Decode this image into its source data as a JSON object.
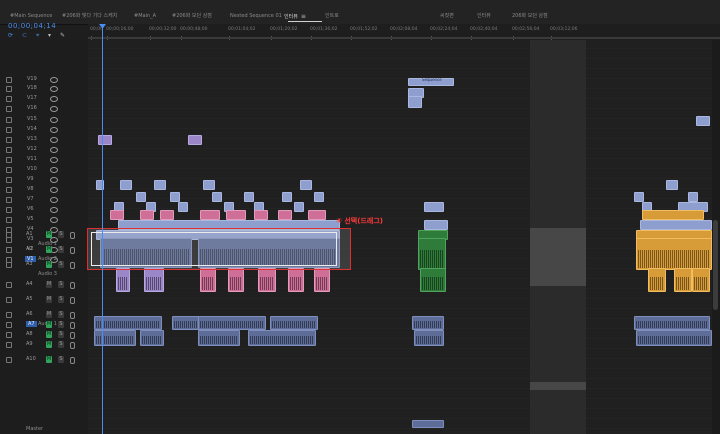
{
  "tabs": [
    {
      "label": "#Main Sequence",
      "active": false
    },
    {
      "label": "#206화 빛다 기다 스케치",
      "active": false
    },
    {
      "label": "#Main_A",
      "active": false
    },
    {
      "label": "#206화 모던 상점",
      "active": false
    },
    {
      "label": "Nested Sequence 01",
      "active": false
    },
    {
      "label": "인터뷰",
      "active": true,
      "close": "≡"
    },
    {
      "label": "인트로",
      "active": false
    },
    {
      "label": "씨컷편",
      "active": false
    },
    {
      "label": "인터뷰",
      "active": false
    },
    {
      "label": "206화 모던 상점",
      "active": false
    }
  ],
  "timecode": "00;00;04;14",
  "ruler_labels": [
    "00;00",
    "00;00;16;00",
    "00;00;32;00",
    "00;00;48;00",
    "00;01;04;02",
    "00;01;20;02",
    "00;01;36;02",
    "00;01;52;02",
    "00;02;08;04",
    "00;02;24;04",
    "00;02;40;04",
    "00;02;56;04",
    "00;03;12;06"
  ],
  "video_tracks": [
    "V19",
    "V18",
    "V17",
    "V16",
    "V15",
    "V14",
    "V13",
    "V12",
    "V11",
    "V10",
    "V9",
    "V8",
    "V7",
    "V6",
    "V5",
    "V4",
    "V3",
    "V2",
    "V1"
  ],
  "audio_tracks": [
    {
      "id": "A1",
      "name": "Audio 1"
    },
    {
      "id": "A2",
      "name": "Audio 2"
    },
    {
      "id": "A3",
      "name": "Audio 3"
    },
    {
      "id": "A4",
      "name": ""
    },
    {
      "id": "A5",
      "name": ""
    },
    {
      "id": "A6",
      "name": "Audio 1"
    },
    {
      "id": "A7",
      "name": ""
    },
    {
      "id": "A8",
      "name": ""
    },
    {
      "id": "A9",
      "name": ""
    },
    {
      "id": "A10",
      "name": ""
    }
  ],
  "track_buttons": {
    "mute": "M",
    "solo": "S"
  },
  "bottom_label": "Master",
  "clip_label_sequence": "Sequence",
  "annotation": "④ 선택(드래그)",
  "colors": {
    "accent": "#4a8df0",
    "selection": "#dd3030"
  }
}
